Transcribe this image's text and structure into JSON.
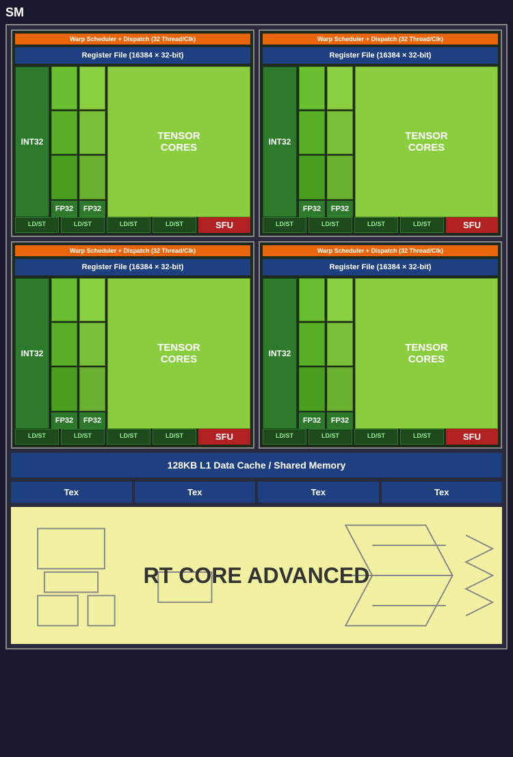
{
  "title": "SM",
  "sub_sms": [
    {
      "id": 1,
      "warp_scheduler": "Warp Scheduler + Dispatch (32 Thread/Clk)",
      "register_file": "Register File (16384 × 32-bit)",
      "int32_label": "INT32",
      "fp32_label1": "FP32",
      "fp32_label2": "FP32",
      "tensor_label": "TENSOR\nCORES",
      "ldst_labels": [
        "LD/ST",
        "LD/ST",
        "LD/ST",
        "LD/ST"
      ],
      "sfu_label": "SFU"
    },
    {
      "id": 2,
      "warp_scheduler": "Warp Scheduler + Dispatch (32 Thread/Clk)",
      "register_file": "Register File (16384 × 32-bit)",
      "int32_label": "INT32",
      "fp32_label1": "FP32",
      "fp32_label2": "FP32",
      "tensor_label": "TENSOR\nCORES",
      "ldst_labels": [
        "LD/ST",
        "LD/ST",
        "LD/ST",
        "LD/ST"
      ],
      "sfu_label": "SFU"
    },
    {
      "id": 3,
      "warp_scheduler": "Warp Scheduler + Dispatch (32 Thread/Clk)",
      "register_file": "Register File (16384 × 32-bit)",
      "int32_label": "INT32",
      "fp32_label1": "FP32",
      "fp32_label2": "FP32",
      "tensor_label": "TENSOR\nCORES",
      "ldst_labels": [
        "LD/ST",
        "LD/ST",
        "LD/ST",
        "LD/ST"
      ],
      "sfu_label": "SFU"
    },
    {
      "id": 4,
      "warp_scheduler": "Warp Scheduler + Dispatch (32 Thread/Clk)",
      "register_file": "Register File (16384 × 32-bit)",
      "int32_label": "INT32",
      "fp32_label1": "FP32",
      "fp32_label2": "FP32",
      "tensor_label": "TENSOR\nCORES",
      "ldst_labels": [
        "LD/ST",
        "LD/ST",
        "LD/ST",
        "LD/ST"
      ],
      "sfu_label": "SFU"
    }
  ],
  "l1_cache_label": "128KB L1 Data Cache / Shared Memory",
  "tex_labels": [
    "Tex",
    "Tex",
    "Tex",
    "Tex"
  ],
  "rt_core_label": "RT CORE ADVANCED"
}
